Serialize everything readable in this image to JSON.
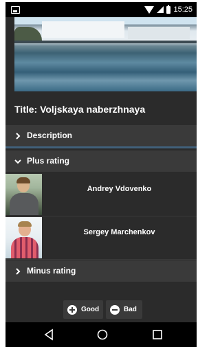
{
  "status": {
    "time": "15:25"
  },
  "place": {
    "title": "Title: Voljskaya naberzhnaya"
  },
  "sections": {
    "description": "Description",
    "plus_rating": "Plus rating",
    "minus_rating": "Minus rating"
  },
  "plus_people": [
    {
      "name": "Andrey Vdovenko"
    },
    {
      "name": "Sergey Marchenkov"
    }
  ],
  "actions": {
    "good": "Good",
    "bad": "Bad"
  },
  "icons": {
    "status_left": "image-icon",
    "wifi": "wifi-icon",
    "signal": "signal-icon",
    "battery": "battery-icon",
    "nav_back": "back-icon",
    "nav_home": "home-icon",
    "nav_recent": "recent-apps-icon"
  },
  "colors": {
    "background": "#2b2b2b",
    "section": "#3a3a3a",
    "accent": "#41607a"
  }
}
